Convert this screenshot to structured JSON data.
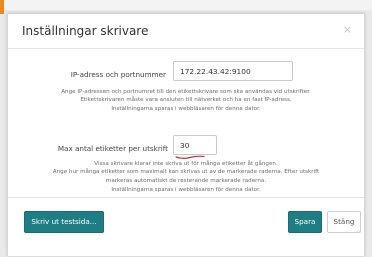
{
  "dialog": {
    "title": "Inställningar skrivare",
    "close_glyph": "×"
  },
  "ip": {
    "label": "IP-adress och portnummer",
    "value": "172.22.43.42:9100",
    "help": [
      "Ange IP-adressen och portnumret till den etikettskrivare som ska användas vid utskrifter.",
      "Etikettskrivaren måste vara ansluten till nätverket och ha en fast IP-adress.",
      "Inställningarna sparas i webbläsaren för denna dator."
    ]
  },
  "max": {
    "label": "Max antal etiketter per utskrift",
    "value": "30",
    "help": [
      "Vissa skrivare klarar inte skriva ut för många etiketter åt gången.",
      "Ange hur många etiketter som maximalt kan skrivas ut av de markerade raderna. Efter utskrift",
      "markeras automatiskt de resterande markerade raderna.",
      "Inställningarna sparas i webbläsaren för denna dator."
    ]
  },
  "footer": {
    "test_print": "Skriv ut testsida...",
    "save": "Spara",
    "close": "Stäng"
  },
  "colors": {
    "accent": "#1f7e85",
    "annotation_red": "#d62828"
  },
  "icons": {
    "close": "close-icon"
  }
}
